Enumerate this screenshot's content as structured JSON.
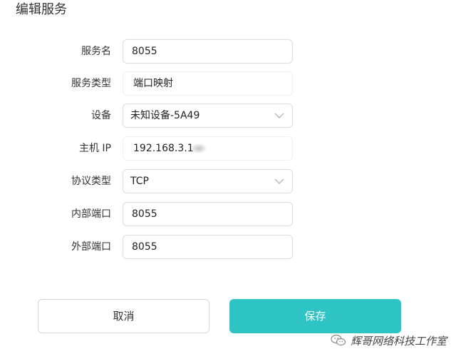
{
  "page": {
    "title": "编辑服务"
  },
  "form": {
    "service_name": {
      "label": "服务名",
      "value": "8055"
    },
    "service_type": {
      "label": "服务类型",
      "value": "端口映射"
    },
    "device": {
      "label": "设备",
      "value": "未知设备-5A49"
    },
    "host_ip": {
      "label": "主机 IP",
      "value": "192.168.3.1"
    },
    "protocol": {
      "label": "协议类型",
      "value": "TCP"
    },
    "internal_port": {
      "label": "内部端口",
      "value": "8055"
    },
    "external_port": {
      "label": "外部端口",
      "value": "8055"
    }
  },
  "actions": {
    "cancel_label": "取消",
    "save_label": "保存"
  },
  "watermark": {
    "text": "辉哥网络科技工作室",
    "icon": "wechat-icon"
  },
  "colors": {
    "primary": "#2ec4c4",
    "border": "#dcdcdc",
    "text": "#333333"
  }
}
